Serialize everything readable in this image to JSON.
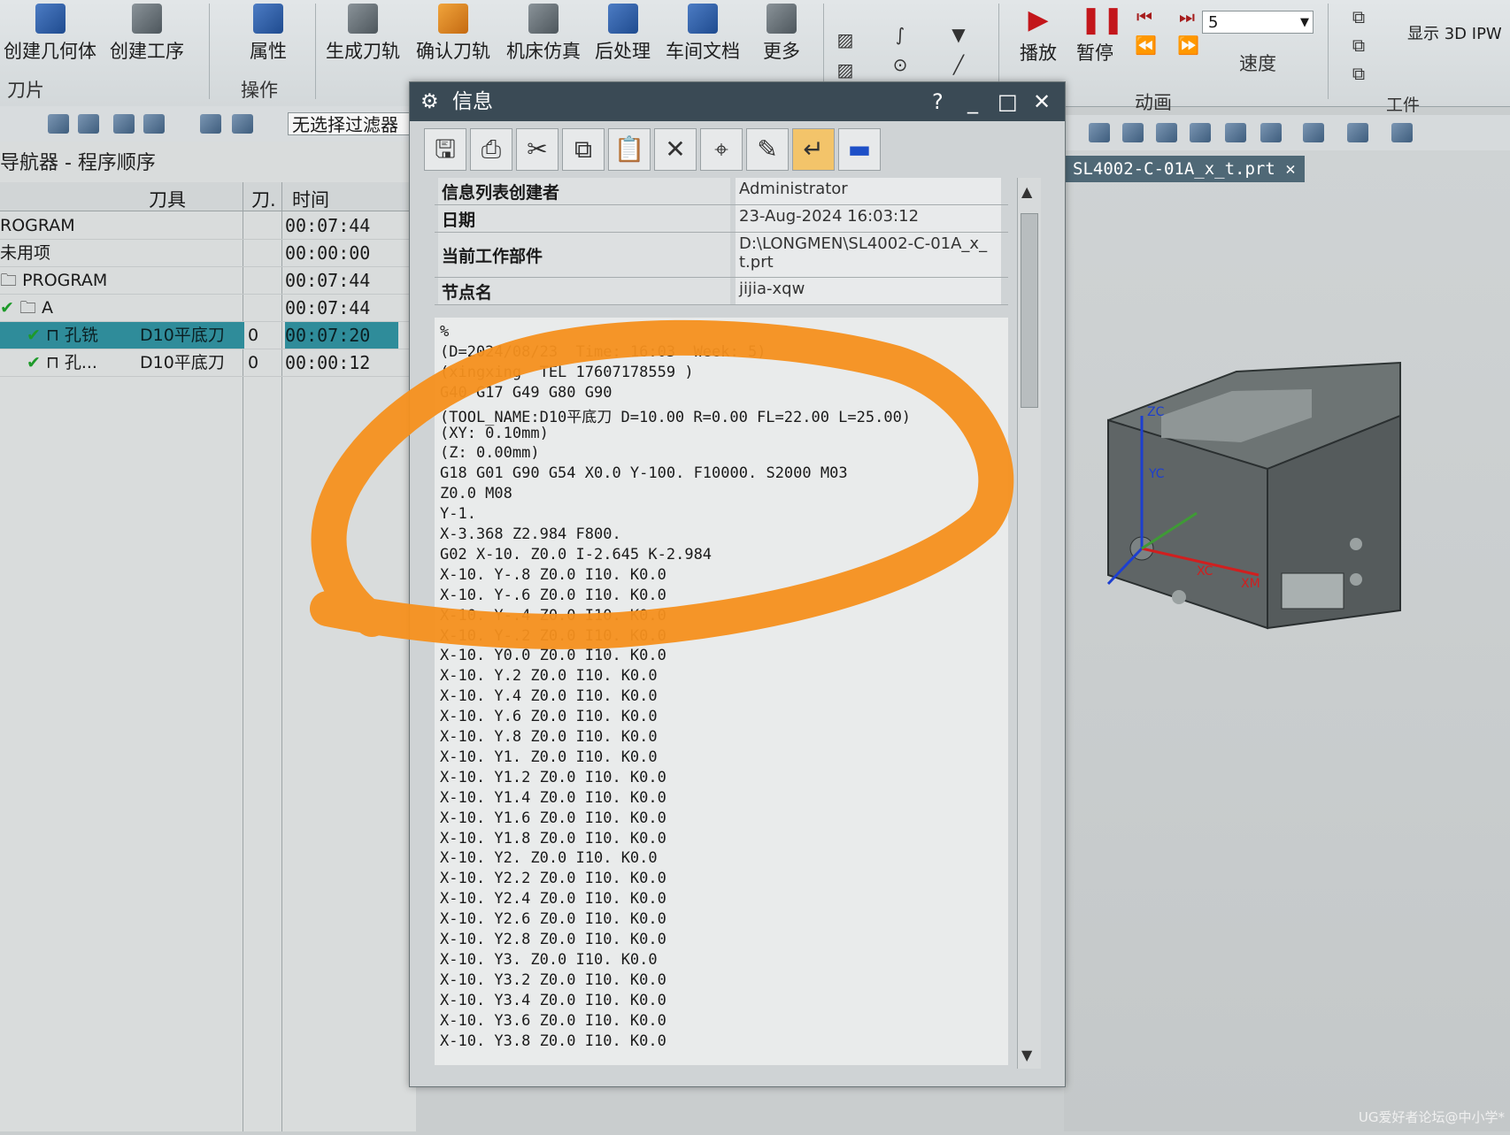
{
  "ribbon": {
    "buttons": [
      {
        "label": "创建几何体"
      },
      {
        "label": "创建工序"
      },
      {
        "label": "属性"
      },
      {
        "label": "生成刀轨"
      },
      {
        "label": "确认刀轨"
      },
      {
        "label": "机床仿真"
      },
      {
        "label": "后处理"
      },
      {
        "label": "车间文档"
      },
      {
        "label": "更多"
      },
      {
        "label": "播放"
      },
      {
        "label": "暂停"
      },
      {
        "label": "速度"
      },
      {
        "label": "显示 3D IPW"
      }
    ],
    "groups": {
      "blade": "刀片",
      "operations": "操作",
      "animation": "动画",
      "workpiece": "工件"
    },
    "speed_value": "5"
  },
  "toolbar2": {
    "filter": "无选择过滤器"
  },
  "navigator": {
    "title": "导航器 - 程序顺序",
    "columns": {
      "tool": "刀具",
      "tool_no": "刀.",
      "time": "时间"
    },
    "rows": [
      {
        "name": "ROGRAM",
        "tool": "",
        "num": "",
        "time": "00:07:44"
      },
      {
        "name": "未用项",
        "tool": "",
        "num": "",
        "time": "00:00:00"
      },
      {
        "name": "PROGRAM",
        "tool": "",
        "num": "",
        "time": "00:07:44"
      },
      {
        "name": "A",
        "tool": "",
        "num": "",
        "time": "00:07:44"
      },
      {
        "name": "孔铣",
        "tool": "D10平底刀",
        "num": "0",
        "time": "00:07:20"
      },
      {
        "name": "孔...",
        "tool": "D10平底刀",
        "num": "0",
        "time": "00:00:12"
      }
    ]
  },
  "dialog": {
    "title": "信息",
    "controls": {
      "help": "?",
      "minimize": "_",
      "maximize": "□",
      "close": "✕"
    },
    "info": [
      {
        "key": "信息列表创建者",
        "value": "Administrator"
      },
      {
        "key": "日期",
        "value": "23-Aug-2024 16:03:12"
      },
      {
        "key": "当前工作部件",
        "value": "D:\\LONGMEN\\SL4002-C-01A_x_t.prt"
      },
      {
        "key": "节点名",
        "value": "jijia-xqw"
      }
    ],
    "code": [
      "%",
      "(D=2024/08/23  Time: 16:03  Week: 5)",
      "(xingxing  TEL 17607178559 )",
      "G40 G17 G49 G80 G90",
      "(TOOL_NAME:D10平底刀 D=10.00 R=0.00 FL=22.00 L=25.00)",
      "(XY: 0.10mm)",
      "(Z: 0.00mm)",
      "G18 G01 G90 G54 X0.0 Y-100. F10000. S2000 M03",
      "Z0.0 M08",
      "Y-1.",
      "X-3.368 Z2.984 F800.",
      "G02 X-10. Z0.0 I-2.645 K-2.984",
      "X-10. Y-.8 Z0.0 I10. K0.0",
      "X-10. Y-.6 Z0.0 I10. K0.0",
      "X-10. Y-.4 Z0.0 I10. K0.0",
      "X-10. Y-.2 Z0.0 I10. K0.0",
      "X-10. Y0.0 Z0.0 I10. K0.0",
      "X-10. Y.2 Z0.0 I10. K0.0",
      "X-10. Y.4 Z0.0 I10. K0.0",
      "X-10. Y.6 Z0.0 I10. K0.0",
      "X-10. Y.8 Z0.0 I10. K0.0",
      "X-10. Y1. Z0.0 I10. K0.0",
      "X-10. Y1.2 Z0.0 I10. K0.0",
      "X-10. Y1.4 Z0.0 I10. K0.0",
      "X-10. Y1.6 Z0.0 I10. K0.0",
      "X-10. Y1.8 Z0.0 I10. K0.0",
      "X-10. Y2. Z0.0 I10. K0.0",
      "X-10. Y2.2 Z0.0 I10. K0.0",
      "X-10. Y2.4 Z0.0 I10. K0.0",
      "X-10. Y2.6 Z0.0 I10. K0.0",
      "X-10. Y2.8 Z0.0 I10. K0.0",
      "X-10. Y3. Z0.0 I10. K0.0",
      "X-10. Y3.2 Z0.0 I10. K0.0",
      "X-10. Y3.4 Z0.0 I10. K0.0",
      "X-10. Y3.6 Z0.0 I10. K0.0",
      "X-10. Y3.8 Z0.0 I10. K0.0"
    ]
  },
  "viewport": {
    "tab_title": "SL4002-C-01A_x_t.prt",
    "axis_labels": {
      "z": "ZC",
      "y": "YC",
      "x": "XM",
      "xc": "XC"
    }
  },
  "watermark": "UG爱好者论坛@中小学*",
  "colors": {
    "highlight_stroke": "#f5901e",
    "title_bar": "#3a4a55",
    "selection": "#2f8c9a",
    "check": "#1d9a2a"
  }
}
